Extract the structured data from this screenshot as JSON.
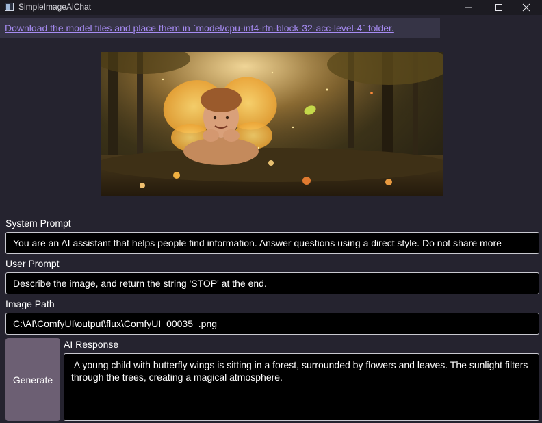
{
  "window": {
    "title": "SimpleImageAiChat"
  },
  "notice": {
    "download_text": "Download the model files and place them in `model/cpu-int4-rtn-block-32-acc-level-4` folder."
  },
  "image": {
    "subject_icon": "fairy-child-image"
  },
  "system_prompt": {
    "label": "System Prompt",
    "value": "You are an AI assistant that helps people find information. Answer questions using a direct style. Do not share more"
  },
  "user_prompt": {
    "label": "User Prompt",
    "value": "Describe the image, and return the string 'STOP' at the end."
  },
  "image_path": {
    "label": "Image Path",
    "value": "C:\\AI\\ComfyUI\\output\\flux\\ComfyUI_00035_.png"
  },
  "generate": {
    "label": "Generate"
  },
  "response": {
    "label": "AI Response",
    "value": " A young child with butterfly wings is sitting in a forest, surrounded by flowers and leaves. The sunlight filters through the trees, creating a magical atmosphere."
  },
  "colors": {
    "background": "#25232f",
    "link": "#a68bf2",
    "button": "#6c5f73",
    "input_bg": "#000000"
  }
}
